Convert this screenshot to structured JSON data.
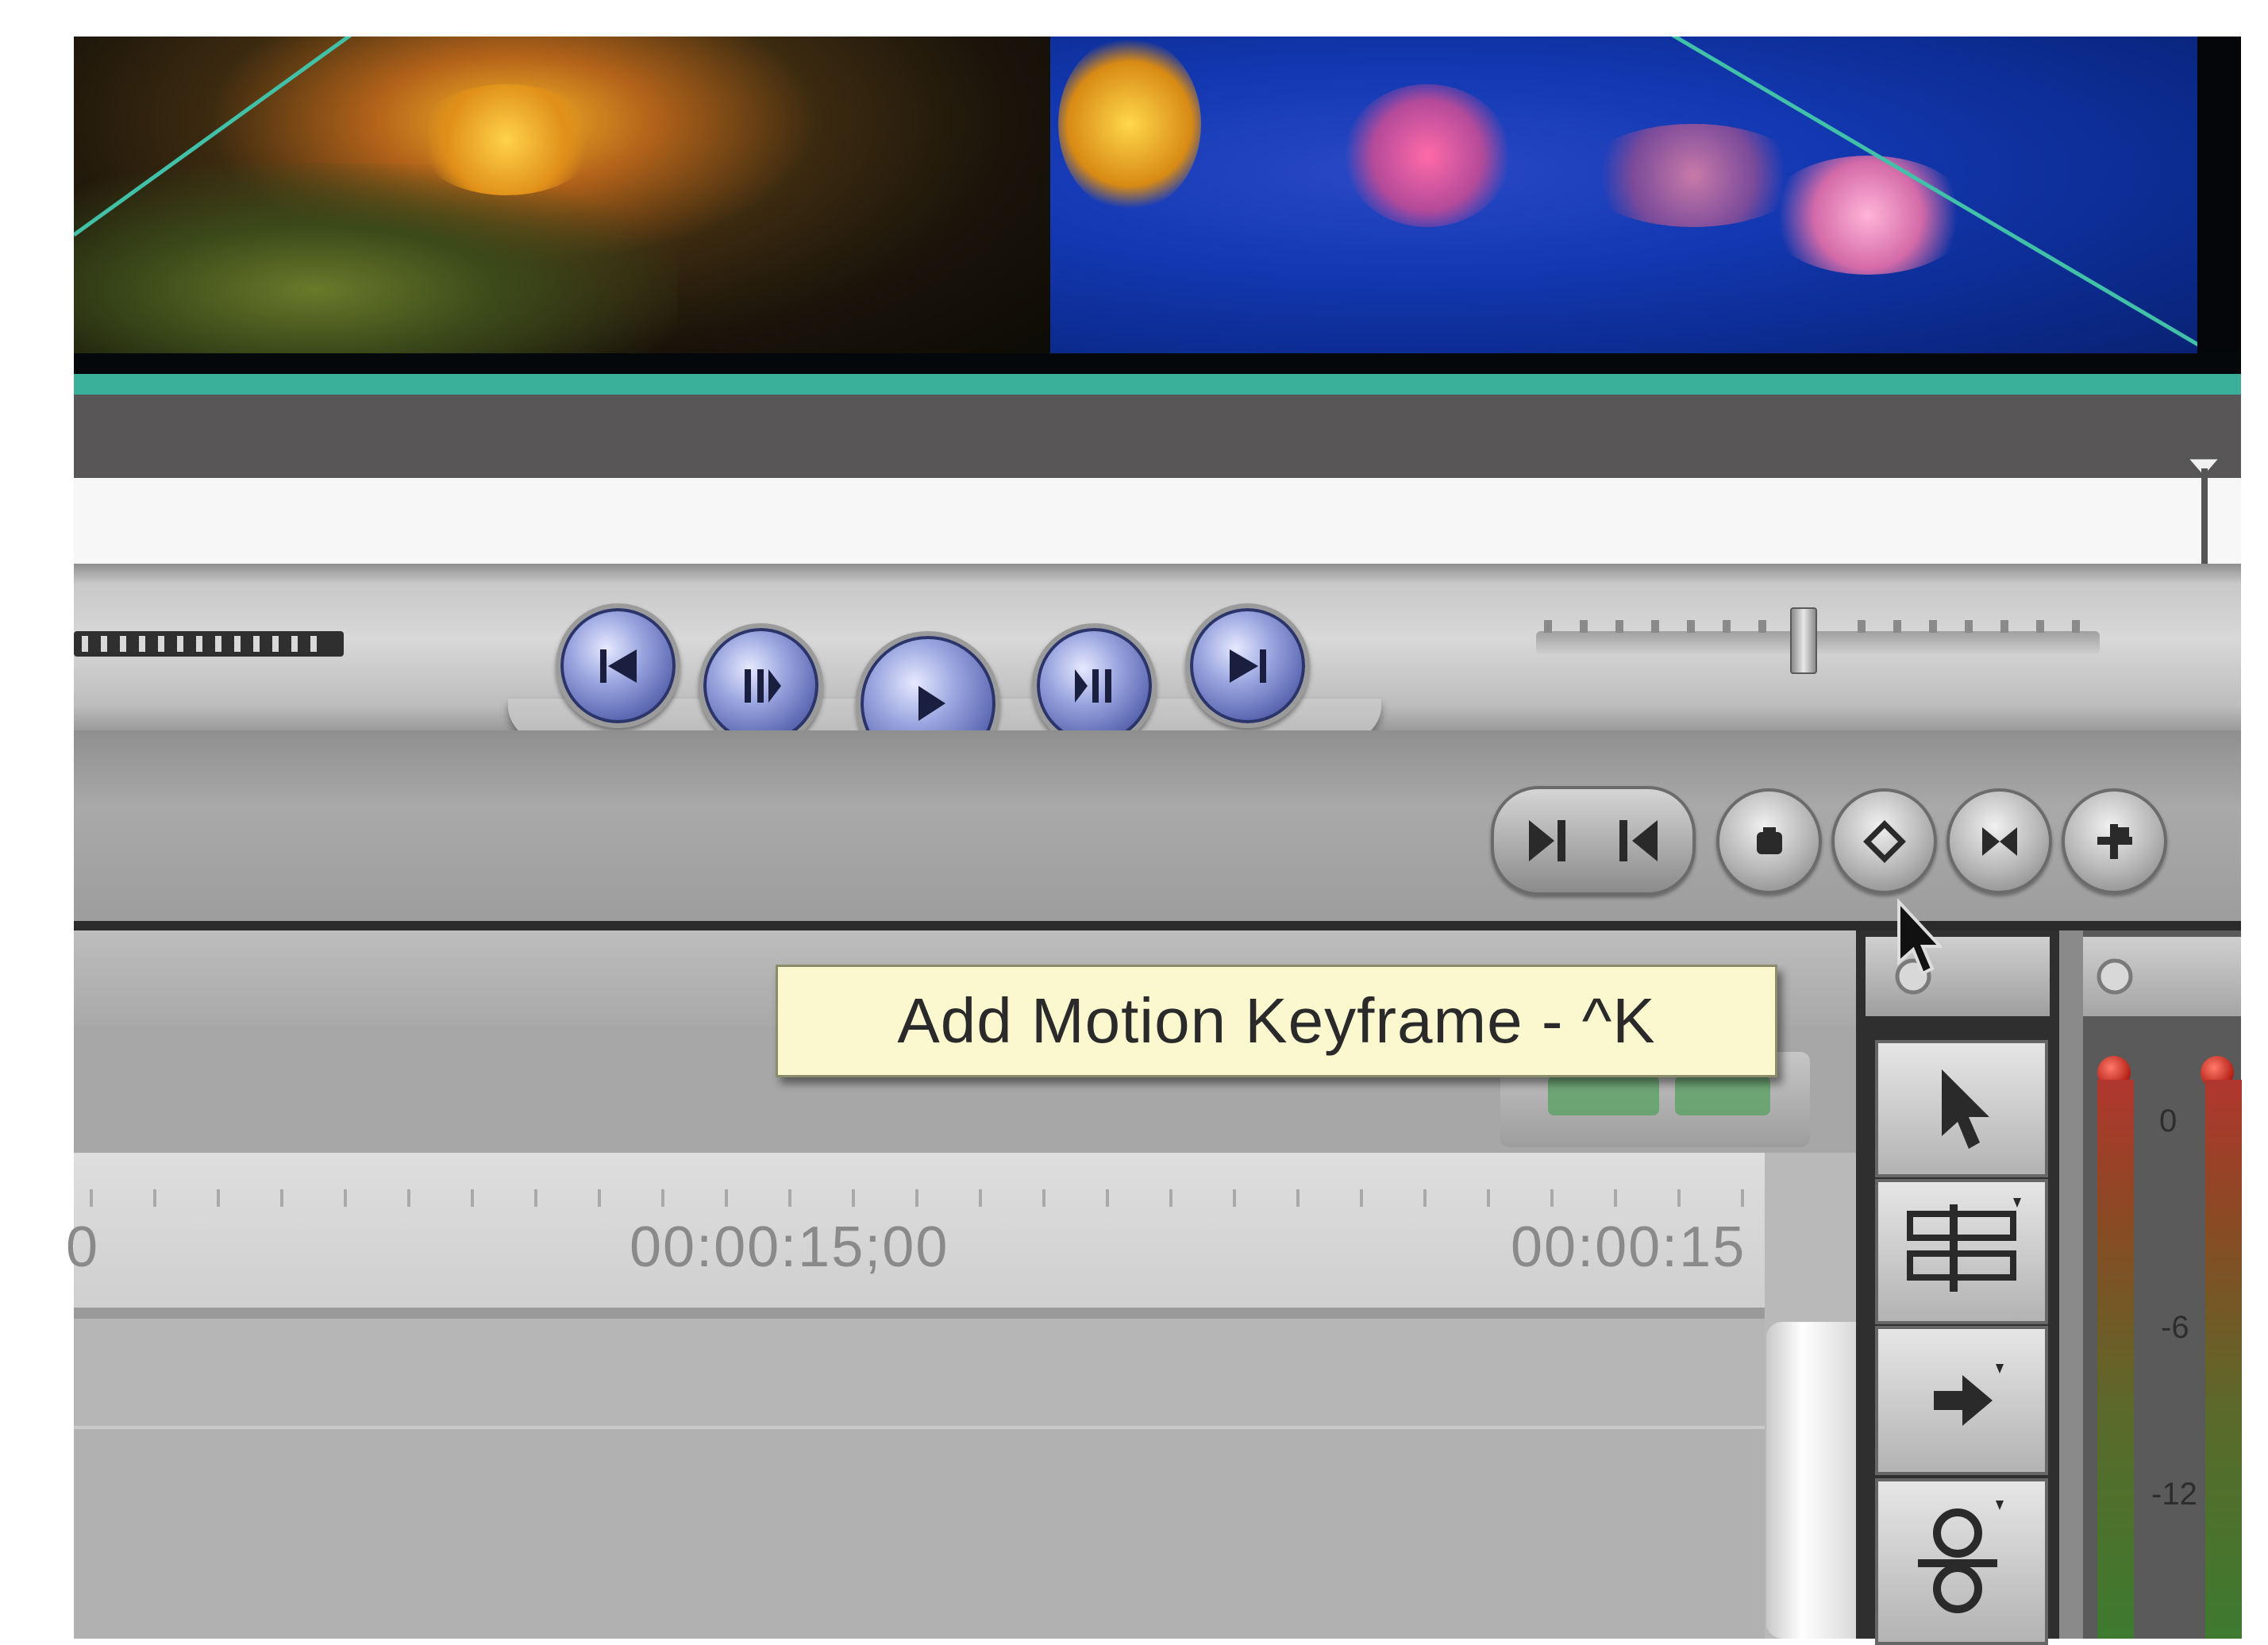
{
  "tooltip": {
    "text": "Add Motion Keyframe - ^K"
  },
  "timeline": {
    "timecodes": [
      "0",
      "00:00:15;00",
      "00:00:15"
    ]
  },
  "transport": {
    "buttons": [
      {
        "name": "go-to-in-point",
        "icon": "skip-back-icon"
      },
      {
        "name": "previous-edit",
        "icon": "previous-frame-icon"
      },
      {
        "name": "play",
        "icon": "play-icon"
      },
      {
        "name": "next-edit",
        "icon": "next-frame-icon"
      },
      {
        "name": "go-to-out-point",
        "icon": "skip-forward-icon"
      }
    ]
  },
  "canvas_buttons": [
    {
      "name": "mark-in",
      "icon": "mark-in-icon"
    },
    {
      "name": "mark-out",
      "icon": "mark-out-icon"
    },
    {
      "name": "match-frame",
      "icon": "match-frame-icon"
    },
    {
      "name": "add-motion-keyframe",
      "icon": "diamond-keyframe-icon"
    },
    {
      "name": "mark-clip",
      "icon": "mark-clip-icon"
    },
    {
      "name": "add-marker",
      "icon": "add-marker-icon"
    }
  ],
  "tools": [
    {
      "name": "selection-tool",
      "icon": "arrow-pointer-icon"
    },
    {
      "name": "edit-selection-tool",
      "icon": "edit-select-icon"
    },
    {
      "name": "track-select-tool",
      "icon": "track-forward-icon"
    },
    {
      "name": "roll-tool",
      "icon": "roll-edit-icon"
    }
  ],
  "audio_meter": {
    "labels": [
      "0",
      "-6",
      "-12"
    ]
  },
  "colors": {
    "tooltip_bg": "#fbf7cf",
    "accent_cyan": "#3ab09a",
    "button_blue": "#5d6ab3"
  }
}
